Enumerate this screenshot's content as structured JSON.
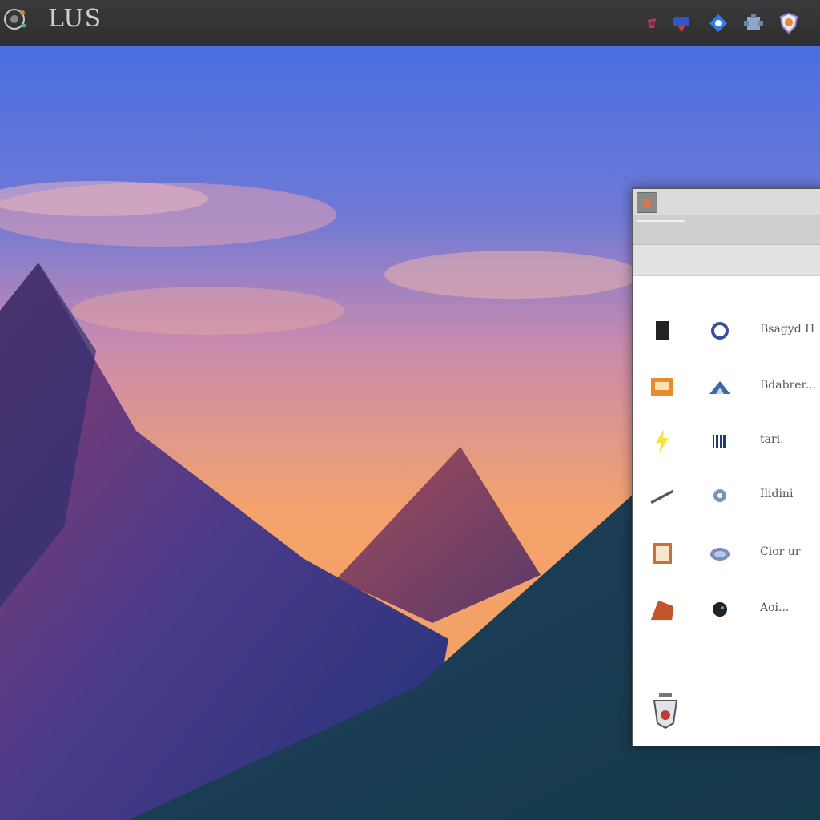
{
  "topbar": {
    "title": "LUS",
    "tray_icons": [
      "app-icon",
      "network-icon",
      "location-icon",
      "puzzle-icon",
      "shield-icon"
    ]
  },
  "desktop": {
    "wallpaper": "mountains-sunset",
    "colors": {
      "sky_top": "#4a6fe0",
      "sky_mid": "#b47aa8",
      "sky_low": "#f4a36c",
      "peak": "#8a4a7a",
      "hill": "#1f4f5e"
    }
  },
  "window": {
    "rows": [
      {
        "icon1": "black-box-icon",
        "icon2": "ring-icon",
        "label": "Bsagyd H"
      },
      {
        "icon1": "photo-icon",
        "icon2": "mountain-icon",
        "label": "Bdabrer..."
      },
      {
        "icon1": "lightning-icon",
        "icon2": "barcode-icon",
        "label": "tari."
      },
      {
        "icon1": "pen-icon",
        "icon2": "gear-icon",
        "label": "Ilidini"
      },
      {
        "icon1": "frame-icon",
        "icon2": "cloud-icon",
        "label": "Cior ur"
      },
      {
        "icon1": "basket-icon",
        "icon2": "bug-icon",
        "label": "Aoi..."
      }
    ]
  }
}
